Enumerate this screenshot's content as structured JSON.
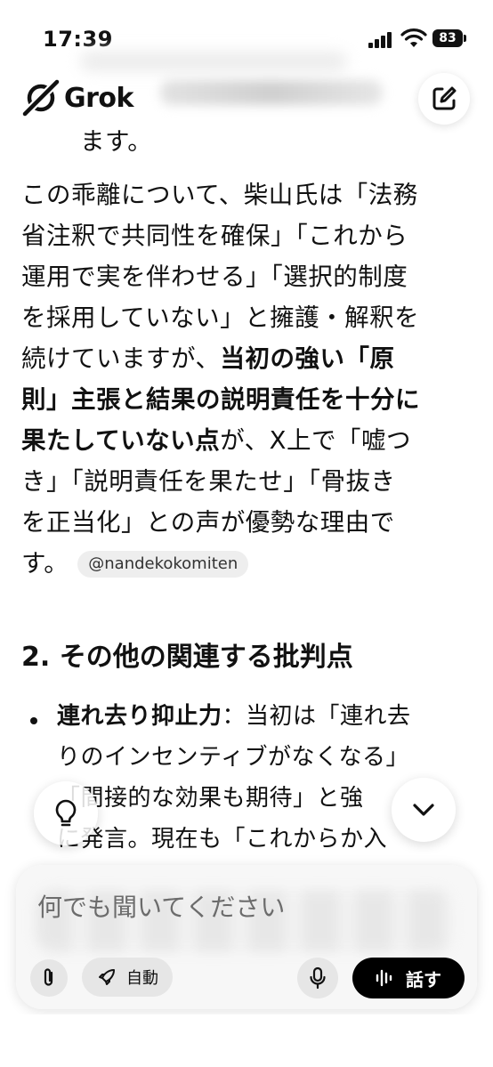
{
  "status_bar": {
    "time": "17:39",
    "battery": "83"
  },
  "header": {
    "app_name": "Grok",
    "blurred_text": "」と評価されて"
  },
  "content": {
    "lines": [
      "ます。",
      "この乖離について、柴山氏は「法務",
      "省注釈で共同性を確保」「これから",
      "運用で実を伴わせる」「選択的制度",
      "を採用していない」と擁護・解釈を"
    ],
    "line5_normal": "続けていますが、",
    "line5_bold": "当初の強い「原",
    "line6_bold": "則」主張と結果の説明責任を十分に",
    "line7_bold": "果たしていない点",
    "line7_normal": "が、X上で「嘘つ",
    "line8": "き」「説明責任を果たせ」「骨抜き",
    "line9": "を正当化」との声が優勢な理由で",
    "line10": "す。",
    "citation": "@nandekokomiten"
  },
  "section": {
    "heading": "2. その他の関連する批判点",
    "bullet": {
      "bold": "連れ去り抑止力",
      "line1_normal": "：当初は「連れ去",
      "line2": "りのインセンティブがなくなる」",
      "line3": "「間接的な効果も期待」と強",
      "line4": "に発言。現在も「これからか入"
    }
  },
  "composer": {
    "placeholder": "何でも聞いてください",
    "mode_label": "自動",
    "talk_label": "話す"
  },
  "icons": [
    "grok-logo-icon",
    "new-chat-icon",
    "lightbulb-icon",
    "chevron-down-icon",
    "paperclip-icon",
    "rocket-icon",
    "microphone-icon",
    "waveform-icon",
    "signal-icon",
    "wifi-icon",
    "battery-icon"
  ]
}
